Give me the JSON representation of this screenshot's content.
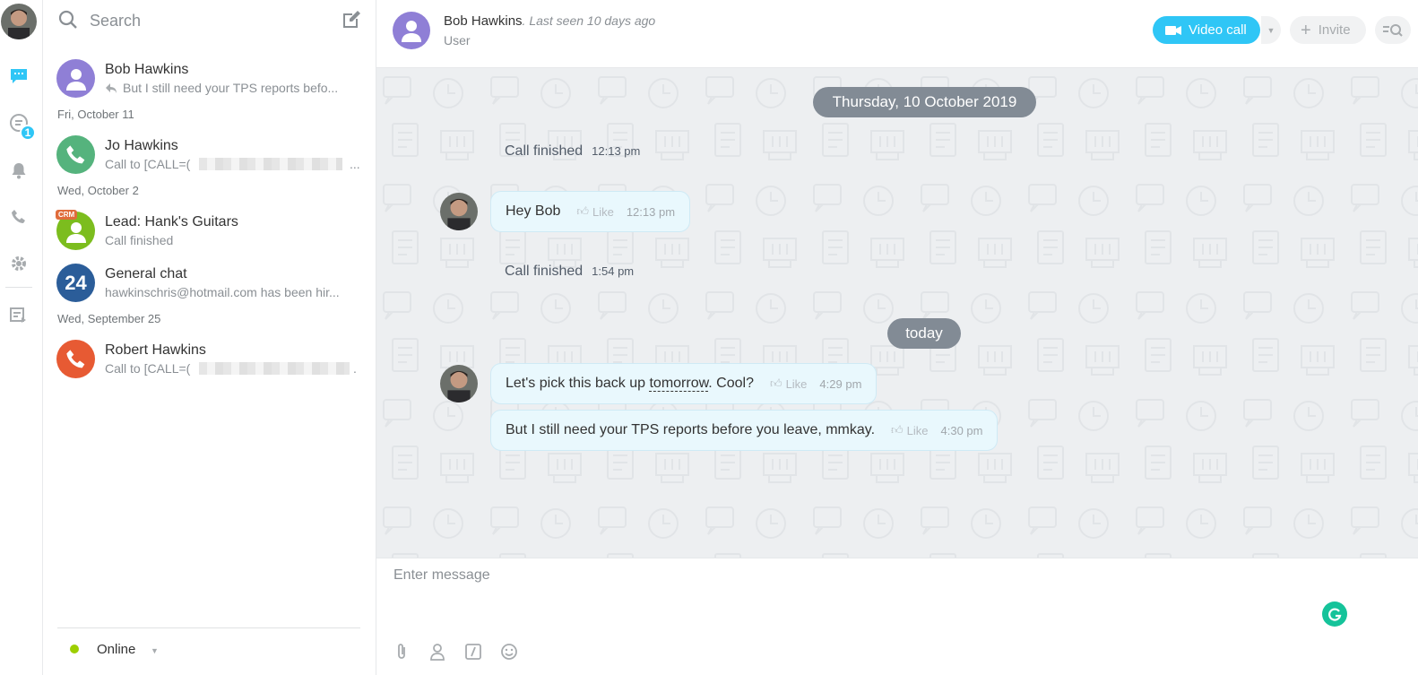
{
  "colors": {
    "accent": "#2fc6f6",
    "chat_bg": "#edeff1",
    "date_pill": "#828b95",
    "bubble": "#e9f8fd",
    "online": "#9dcf00",
    "grammarly": "#15c39a"
  },
  "rail": {
    "icons": [
      "user-avatar",
      "chat-icon",
      "open-lines-icon",
      "bell-icon",
      "phone-icon",
      "gear-icon",
      "export-icon"
    ],
    "badge": "1"
  },
  "search": {
    "placeholder": "Search"
  },
  "recent": {
    "items": [
      {
        "name": "Bob Hawkins",
        "preview": "But I still need your TPS reports befo..."
      },
      {
        "name": "Jo Hawkins",
        "preview": "Call to [CALL=(",
        "tail": "..."
      },
      {
        "name": "Lead: Hank's Guitars",
        "preview": "Call finished",
        "tag": "CRM"
      },
      {
        "name": "General chat",
        "preview": "hawkinschris@hotmail.com has been hir...",
        "avatar_text": "24"
      },
      {
        "name": "Robert Hawkins",
        "preview": "Call to [CALL=(",
        "tail": "."
      }
    ],
    "date_labels": [
      "Fri, October 11",
      "Wed, October 2",
      "Wed, September 25"
    ]
  },
  "status": {
    "label": "Online"
  },
  "header": {
    "name": "Bob Hawkins",
    "last_seen": ". Last seen 10 days ago",
    "role": "User",
    "video_call": "Video call",
    "invite": "Invite"
  },
  "chat": {
    "date_pills": [
      "Thursday, 10 October 2019",
      "today"
    ],
    "system": [
      {
        "text": "Call finished",
        "time": "12:13 pm"
      },
      {
        "text": "Call finished",
        "time": "1:54 pm"
      }
    ],
    "messages": [
      {
        "text": "Hey Bob",
        "like": "Like",
        "time": "12:13 pm"
      },
      {
        "text_before": "Let's pick this back up ",
        "text_link": "tomorrow",
        "text_after": ". Cool?",
        "like": "Like",
        "time": "4:29 pm"
      },
      {
        "text": "But I still need your TPS reports before you leave, mmkay.",
        "like": "Like",
        "time": "4:30 pm"
      }
    ]
  },
  "composer": {
    "placeholder": "Enter message"
  }
}
